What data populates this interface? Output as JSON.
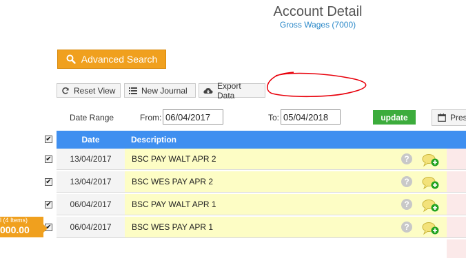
{
  "header": {
    "title": "Account Detail",
    "subtitle": "Gross Wages (7000)"
  },
  "search": {
    "advanced_label": "Advanced Search"
  },
  "toolbar": {
    "reset_label": "Reset View",
    "journal_label": "New Journal",
    "export_label": "Export Data"
  },
  "filter": {
    "range_label": "Date Range",
    "from_label": "From:",
    "from_value": "06/04/2017",
    "to_label": "To:",
    "to_value": "05/04/2018",
    "update_label": "update",
    "preset_label": "Pres"
  },
  "table": {
    "columns": [
      "Date",
      "Description"
    ],
    "rows": [
      {
        "date": "13/04/2017",
        "description": "BSC PAY WALT APR 2"
      },
      {
        "date": "13/04/2017",
        "description": "BSC WES PAY APR 2"
      },
      {
        "date": "06/04/2017",
        "description": "BSC PAY WALT APR 1"
      },
      {
        "date": "06/04/2017",
        "description": "BSC WES PAY APR 1"
      }
    ]
  },
  "selection": {
    "summary": "l (4 Items)",
    "amount": "000.00"
  },
  "icons": {
    "search": "search-icon",
    "reset": "refresh-icon",
    "journal": "list-icon",
    "export": "cloud-download-icon",
    "calendar": "calendar-icon",
    "help": "help-icon",
    "comment": "add-comment-icon"
  },
  "colors": {
    "accent": "#f0a01e",
    "header": "#3f8ff0",
    "update": "#3cac3c",
    "highlight": "#fdfdc5",
    "annotation": "#e8000b"
  }
}
